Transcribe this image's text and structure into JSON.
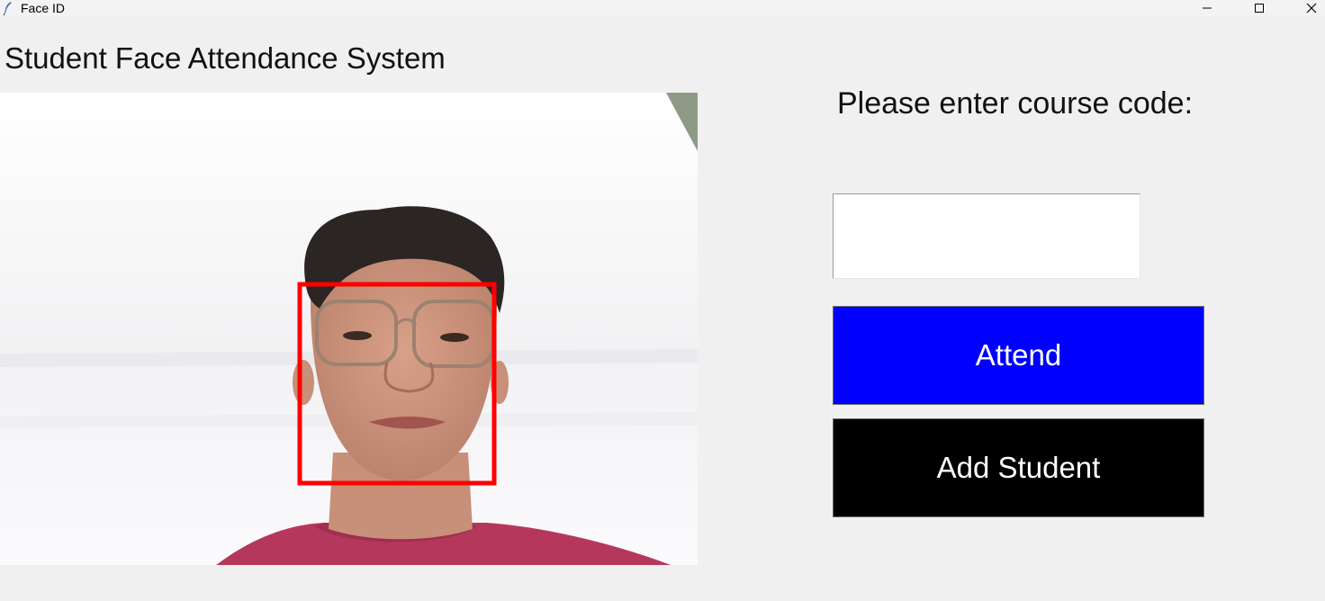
{
  "window": {
    "title": "Face ID",
    "icon": "feather-icon",
    "controls": [
      "minimize-icon",
      "maximize-icon",
      "close-icon"
    ]
  },
  "heading": "Student Face Attendance System",
  "camera": {
    "overlay_color": "#ff0000"
  },
  "form": {
    "prompt": "Please enter course code:",
    "course_code_value": "",
    "attend_label": "Attend",
    "add_student_label": "Add Student"
  },
  "colors": {
    "attend_button": "#0000ff",
    "add_student_button": "#000000",
    "face_box": "#ff0000"
  }
}
